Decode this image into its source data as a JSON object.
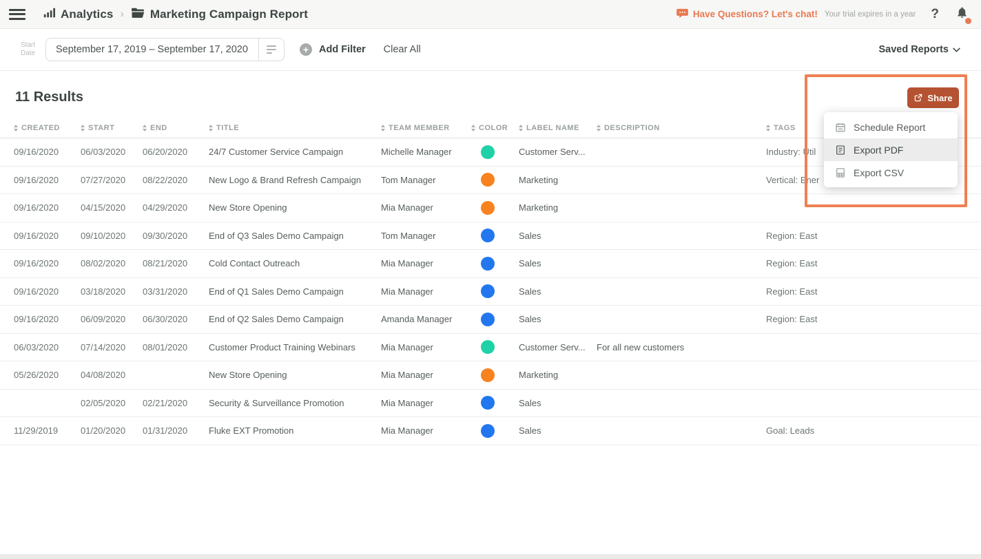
{
  "topbar": {
    "app_name": "Analytics",
    "page_title": "Marketing Campaign Report",
    "chat_text": "Have Questions? Let's chat!",
    "trial_text": "Your trial expires in a year",
    "help_text": "?"
  },
  "filterbar": {
    "field_label_line1": "Start",
    "field_label_line2": "Date",
    "date_range": "September 17, 2019  –  September 17, 2020",
    "add_filter_label": "Add Filter",
    "clear_all_label": "Clear All",
    "saved_reports_label": "Saved Reports"
  },
  "results_heading": "11 Results",
  "table": {
    "columns": [
      "Created",
      "Start",
      "End",
      "Title",
      "Team Member",
      "Color",
      "Label Name",
      "Description",
      "Tags"
    ],
    "rows": [
      {
        "created": "09/16/2020",
        "start": "06/03/2020",
        "end": "06/20/2020",
        "title": "24/7 Customer Service Campaign",
        "team_member": "Michelle Manager",
        "color": "#1fd1a7",
        "label_name": "Customer Serv...",
        "description": "",
        "tags": "Industry: Util"
      },
      {
        "created": "09/16/2020",
        "start": "07/27/2020",
        "end": "08/22/2020",
        "title": "New Logo & Brand Refresh Campaign",
        "team_member": "Tom Manager",
        "color": "#f8821f",
        "label_name": "Marketing",
        "description": "",
        "tags": "Vertical: Ener"
      },
      {
        "created": "09/16/2020",
        "start": "04/15/2020",
        "end": "04/29/2020",
        "title": "New Store Opening",
        "team_member": "Mia Manager",
        "color": "#f8821f",
        "label_name": "Marketing",
        "description": "",
        "tags": ""
      },
      {
        "created": "09/16/2020",
        "start": "09/10/2020",
        "end": "09/30/2020",
        "title": "End of Q3 Sales Demo Campaign",
        "team_member": "Tom Manager",
        "color": "#2277ee",
        "label_name": "Sales",
        "description": "",
        "tags": "Region: East"
      },
      {
        "created": "09/16/2020",
        "start": "08/02/2020",
        "end": "08/21/2020",
        "title": "Cold Contact Outreach",
        "team_member": "Mia Manager",
        "color": "#2277ee",
        "label_name": "Sales",
        "description": "",
        "tags": "Region: East"
      },
      {
        "created": "09/16/2020",
        "start": "03/18/2020",
        "end": "03/31/2020",
        "title": "End of Q1 Sales Demo Campaign",
        "team_member": "Mia Manager",
        "color": "#2277ee",
        "label_name": "Sales",
        "description": "",
        "tags": "Region: East"
      },
      {
        "created": "09/16/2020",
        "start": "06/09/2020",
        "end": "06/30/2020",
        "title": "End of Q2 Sales Demo Campaign",
        "team_member": "Amanda Manager",
        "color": "#2277ee",
        "label_name": "Sales",
        "description": "",
        "tags": "Region: East"
      },
      {
        "created": "06/03/2020",
        "start": "07/14/2020",
        "end": "08/01/2020",
        "title": "Customer Product Training Webinars",
        "team_member": "Mia Manager",
        "color": "#1fd1a7",
        "label_name": "Customer Serv...",
        "description": "For all new customers",
        "tags": ""
      },
      {
        "created": "05/26/2020",
        "start": "04/08/2020",
        "end": "",
        "title": "New Store Opening",
        "team_member": "Mia Manager",
        "color": "#f8821f",
        "label_name": "Marketing",
        "description": "",
        "tags": ""
      },
      {
        "created": "",
        "start": "02/05/2020",
        "end": "02/21/2020",
        "title": "Security & Surveillance Promotion",
        "team_member": "Mia Manager",
        "color": "#2277ee",
        "label_name": "Sales",
        "description": "",
        "tags": ""
      },
      {
        "created": "11/29/2019",
        "start": "01/20/2020",
        "end": "01/31/2020",
        "title": "Fluke EXT Promotion",
        "team_member": "Mia Manager",
        "color": "#2277ee",
        "label_name": "Sales",
        "description": "",
        "tags": "Goal: Leads"
      }
    ]
  },
  "share": {
    "button_label": "Share",
    "menu": [
      {
        "label": "Schedule Report"
      },
      {
        "label": "Export PDF"
      },
      {
        "label": "Export CSV"
      }
    ],
    "highlighted_item": "Export PDF"
  },
  "colors": {
    "annotation_highlight": "#ee8053",
    "share_button": "#b45231",
    "accent_orange": "#e87a51"
  }
}
